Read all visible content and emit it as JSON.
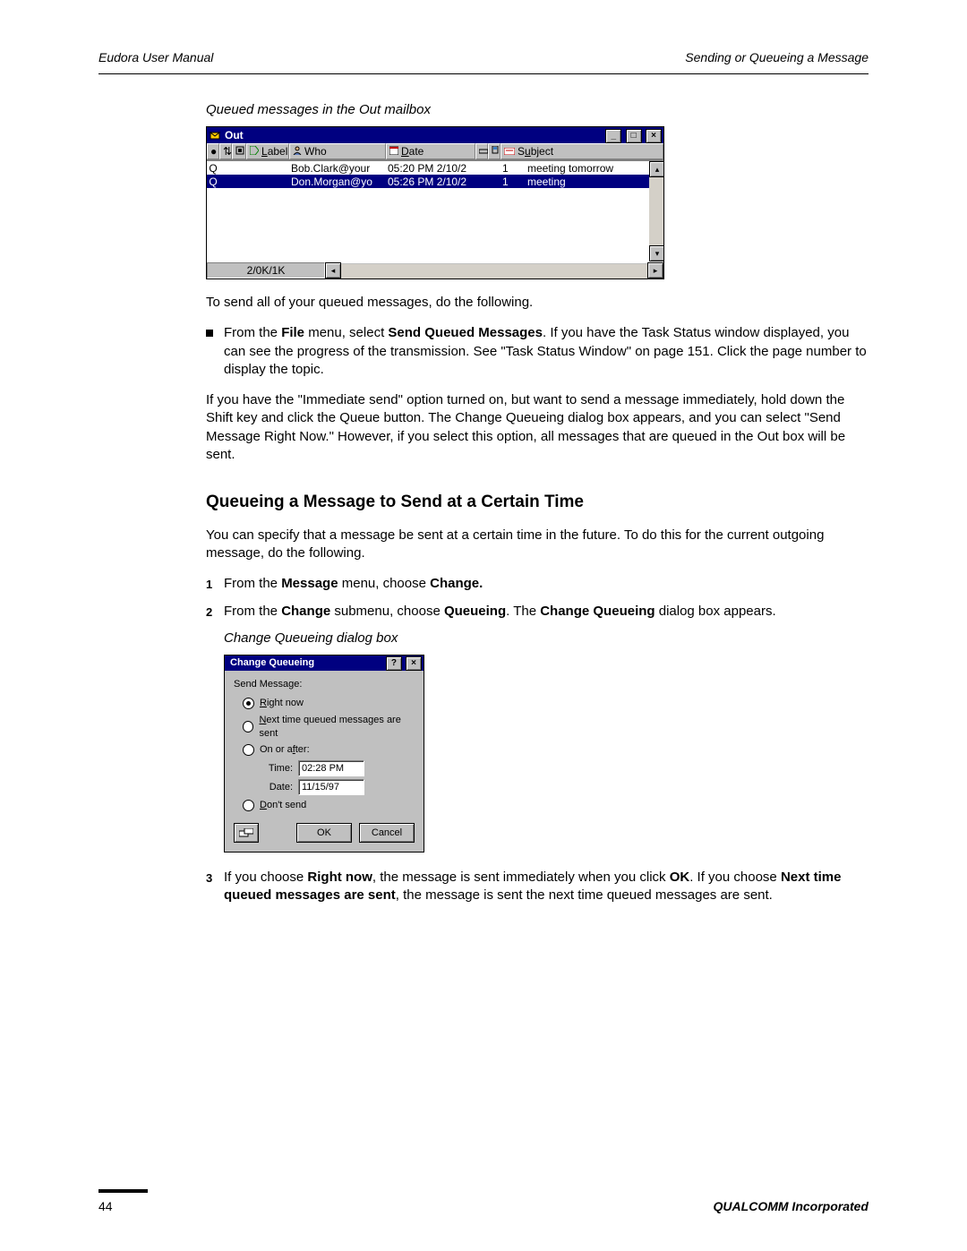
{
  "header": {
    "left": "Eudora User Manual",
    "right": "Sending or Queueing a Message"
  },
  "caption_out": "Queued messages in the Out mailbox",
  "out_window": {
    "title": "Out",
    "columns": {
      "label": "Label",
      "who": "Who",
      "date": "Date",
      "subject": "Subject"
    },
    "rows": [
      {
        "status": "Q",
        "who": "Bob.Clark@your",
        "date": "05:20 PM 2/10/2",
        "size": "1",
        "subject": "meeting tomorrow",
        "selected": false
      },
      {
        "status": "Q",
        "who": "Don.Morgan@yo",
        "date": "05:26 PM 2/10/2",
        "size": "1",
        "subject": "meeting",
        "selected": true
      }
    ],
    "status": "2/0K/1K"
  },
  "para_send_all": "To send all of your queued messages, do the following.",
  "bullet1": {
    "pre": "From the ",
    "b1": "File",
    "mid1": " menu, select ",
    "b2": "Send Queued Messages",
    "post": ". If you have the Task Status window displayed, you can see the progress of the transmission. See \"Task Status Window\" on page 151. Click the page number to display the topic."
  },
  "para_immediate": "If you have the \"Immediate send\" option turned on, but want to send a message immediately, hold down the Shift key and click the Queue button. The Change Queueing dialog box appears, and you can select \"Send Message Right Now.\" However, if you select this option, all messages that are queued in the Out box will be sent.",
  "h2_queue_time": "Queueing a Message to Send at a Certain Time",
  "para_specify": "You can specify that a message be sent at a certain time in the future. To do this for the current outgoing message, do the following.",
  "step1": {
    "pre": "From the ",
    "b1": "Message",
    "mid": " menu, choose ",
    "b2": "Change."
  },
  "step2": {
    "pre": "From the ",
    "b1": "Change",
    "mid1": " submenu, choose ",
    "b2": "Queueing",
    "mid2": ". The ",
    "b3": "Change Queueing",
    "post": " dialog box appears."
  },
  "caption_dlg": "Change Queueing dialog box",
  "dialog": {
    "title": "Change Queueing",
    "label": "Send Message:",
    "opt_right_now": "Right now",
    "opt_next": "Next time queued messages are sent",
    "opt_onafter": "On or after:",
    "time_label": "Time:",
    "time_value": "02:28 PM",
    "date_label": "Date:",
    "date_value": "11/15/97",
    "opt_dont": "Don't send",
    "ok": "OK",
    "cancel": "Cancel"
  },
  "step3": {
    "pre": "If you choose ",
    "b1": "Right now",
    "mid1": ", the message is sent immediately when you click ",
    "b2": "OK",
    "mid2": ". If you choose ",
    "b3": "Next time queued messages are sent",
    "post": ", the message is sent the next time queued messages are sent."
  },
  "footer": {
    "page": "44",
    "company": "QUALCOMM Incorporated"
  }
}
